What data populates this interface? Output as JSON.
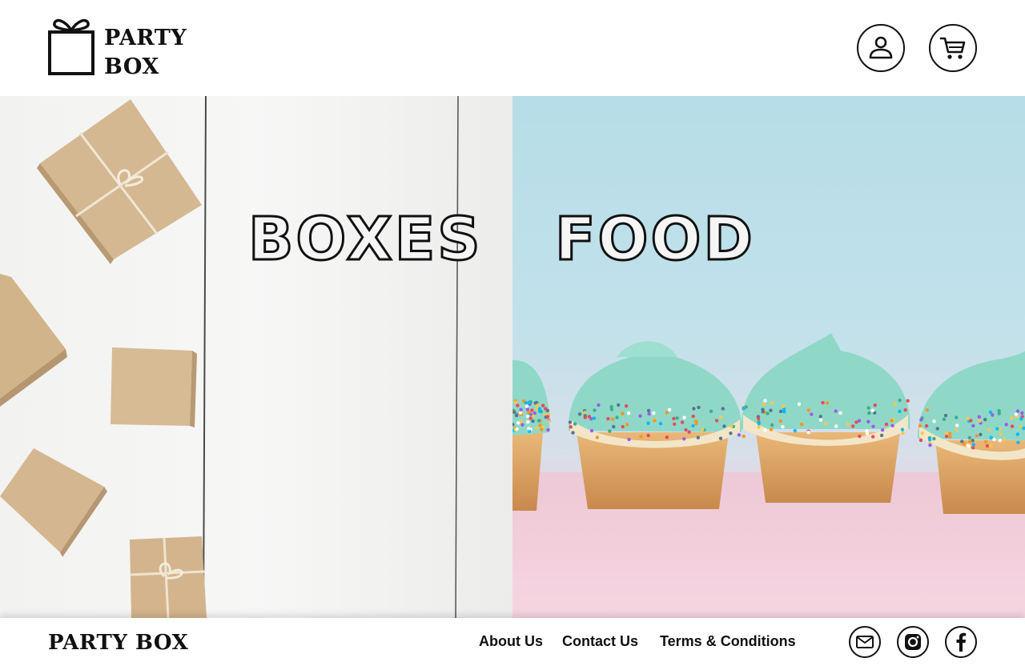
{
  "brand": {
    "logo_line1": "PARTY",
    "logo_line2": "BOX",
    "logo_icon": "gift-box-icon"
  },
  "header": {
    "account_icon": "user-icon",
    "cart_icon": "shopping-cart-icon"
  },
  "categories": [
    {
      "label": "BOXES",
      "image": "kraft gift boxes on white wooden table"
    },
    {
      "label": "FOOD",
      "image": "cupcakes with mint frosting and sprinkles"
    }
  ],
  "footer": {
    "brand": "PARTY BOX",
    "links": [
      "About Us",
      "Contact Us",
      "Terms & Conditions"
    ],
    "social_icons": [
      "mail-icon",
      "instagram-icon",
      "facebook-icon"
    ]
  },
  "colors": {
    "text": "#111111",
    "background": "#ffffff",
    "food_sky": "#b6dde8",
    "frosting": "#8fd8c8",
    "kraft": "#d2b48c"
  }
}
